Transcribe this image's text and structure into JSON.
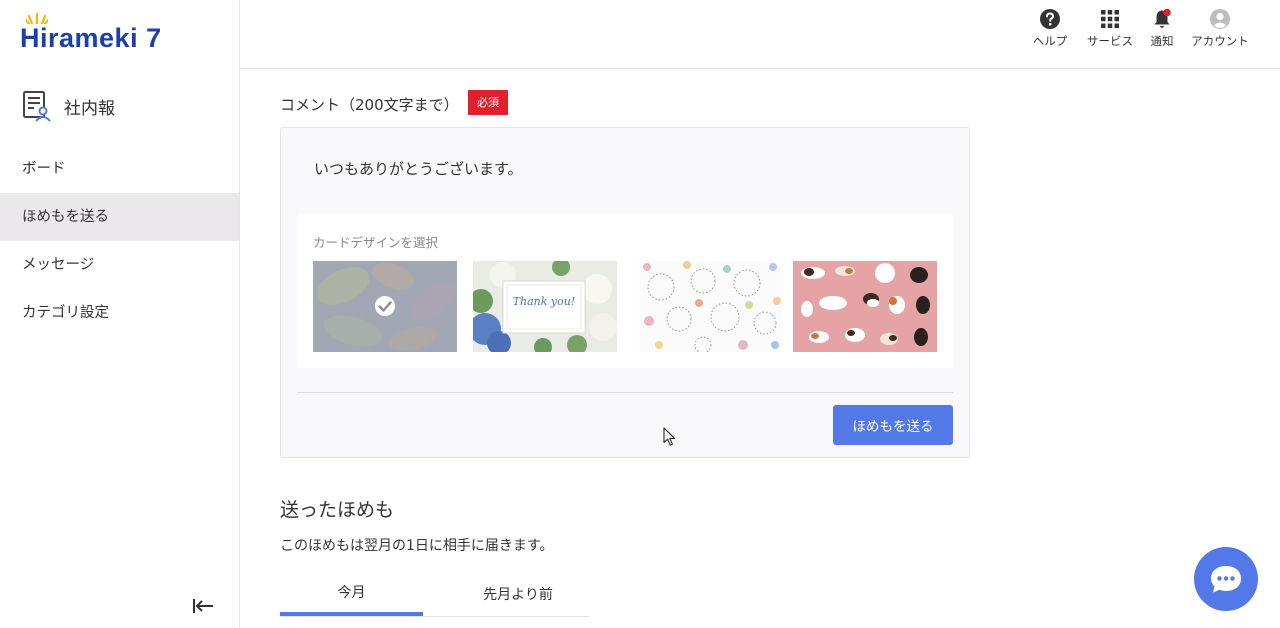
{
  "app": {
    "logo_text": "Hirameki 7"
  },
  "sidebar": {
    "module_label": "社内報",
    "items": [
      {
        "label": "ボード",
        "active": false
      },
      {
        "label": "ほめもを送る",
        "active": true
      },
      {
        "label": "メッセージ",
        "active": false
      },
      {
        "label": "カテゴリ設定",
        "active": false
      }
    ],
    "collapse_icon": "collapse-left-icon"
  },
  "header": {
    "help_label": "ヘルプ",
    "services_label": "サービス",
    "notifications_label": "通知",
    "account_label": "アカウント",
    "notification_dot_color": "#e2202b"
  },
  "form": {
    "comment_label": "コメント（200文字まで）",
    "required_badge": "必須",
    "comment_value": "いつもありがとうございます。",
    "design_title": "カードデザインを選択",
    "designs": [
      {
        "name": "watercolor-leaves",
        "selected": true
      },
      {
        "name": "thank-you-flowers",
        "selected": false,
        "card_text": "Thank you!"
      },
      {
        "name": "fireworks-pattern",
        "selected": false
      },
      {
        "name": "cats-pattern",
        "selected": false
      }
    ],
    "send_button": "ほめもを送る"
  },
  "sent": {
    "title": "送ったほめも",
    "description": "このほめもは翌月の1日に相手に届きます。",
    "tabs": [
      {
        "label": "今月",
        "active": true
      },
      {
        "label": "先月より前",
        "active": false
      }
    ]
  },
  "colors": {
    "brand": "#1c3faa",
    "accent": "#5379e8",
    "required": "#e2202b"
  }
}
